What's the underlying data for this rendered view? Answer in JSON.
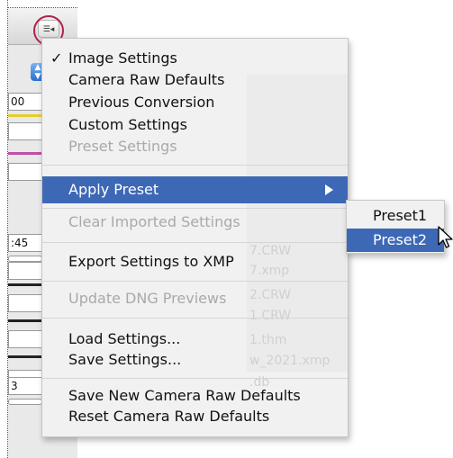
{
  "background_panel": {
    "values": [
      "00",
      ":45",
      "3"
    ]
  },
  "menu": {
    "items": [
      {
        "label": "Image Settings",
        "checked": true,
        "enabled": true
      },
      {
        "label": "Camera Raw Defaults",
        "enabled": true
      },
      {
        "label": "Previous Conversion",
        "enabled": true
      },
      {
        "label": "Custom Settings",
        "enabled": true
      },
      {
        "label": "Preset Settings",
        "enabled": false
      },
      {
        "label": "Apply Preset",
        "enabled": true,
        "highlighted": true,
        "has_submenu": true
      },
      {
        "label": "Clear Imported Settings",
        "enabled": false
      },
      {
        "label": "Export Settings to XMP",
        "enabled": true
      },
      {
        "label": "Update DNG Previews",
        "enabled": false
      },
      {
        "label": "Load Settings...",
        "enabled": true
      },
      {
        "label": "Save Settings...",
        "enabled": true
      },
      {
        "label": "Save New Camera Raw Defaults",
        "enabled": true
      },
      {
        "label": "Reset Camera Raw Defaults",
        "enabled": true
      }
    ],
    "check_glyph": "✓"
  },
  "submenu": {
    "items": [
      {
        "label": "Preset1",
        "highlighted": false
      },
      {
        "label": "Preset2",
        "highlighted": true
      }
    ]
  },
  "ghost_text": [
    "7.CRW",
    "7.xmp",
    "2.CRW",
    "1.CRW",
    "1.thm",
    "w_2021.xmp",
    ".db"
  ],
  "colors": {
    "highlight": "#3d68b6",
    "disabled_text": "#a9a9a9",
    "menu_bg": "#f1f1f1",
    "callout_ring": "#b0234b"
  },
  "icons": {
    "flyout_menu_button": "list-menu-icon",
    "submenu_arrow": "triangle-right-icon",
    "pointer": "arrow-cursor-icon"
  }
}
